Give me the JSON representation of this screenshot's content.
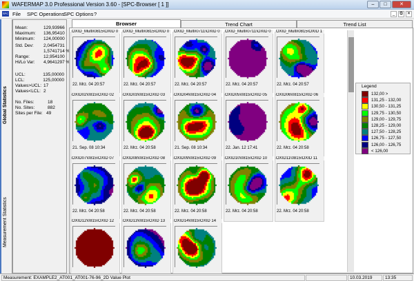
{
  "window": {
    "title": "WAFERMAP 3.0  Professional Version 3.60 - [SPC-Browser [ 1 ]]",
    "controls": [
      "–",
      "□",
      "✕"
    ]
  },
  "menu": {
    "logo": "SPC",
    "items": [
      "File",
      "SPC Operations",
      "SPC Options",
      "?"
    ],
    "mdi_controls": [
      "_",
      "⧉",
      "✕"
    ]
  },
  "side_tabs": [
    "Global Statistics",
    "Measurement Statistics"
  ],
  "stats": [
    {
      "label": "Mean:",
      "value": "129,93966"
    },
    {
      "label": "Maximum:",
      "value": "136,95410"
    },
    {
      "label": "Minimum:",
      "value": "124,00000"
    },
    {
      "label": "Std. Dev:",
      "value": "2,0454731"
    },
    {
      "label": "",
      "value": "1,5741714 %"
    },
    {
      "label": "Range:",
      "value": "12,954100"
    },
    {
      "label": "Hi/Lo Var:",
      "value": "4,9641297 %"
    },
    {
      "label": "UCL:",
      "value": "135,00000"
    },
    {
      "label": "LCL:",
      "value": "125,00000"
    },
    {
      "label": "Values>UCL:",
      "value": "17"
    },
    {
      "label": "Values<LCL:",
      "value": "2"
    },
    {
      "label": "No. Files:",
      "value": "18"
    },
    {
      "label": "No. Sites:",
      "value": "882"
    },
    {
      "label": "Sites per File:",
      "value": "49"
    }
  ],
  "tabs": [
    {
      "label": "Browser",
      "active": true
    },
    {
      "label": "Trend Chart"
    },
    {
      "label": "Trend List"
    }
  ],
  "wafers": [
    {
      "label": "OXID_Multi\\0815\\OXID 0",
      "date": "22. Mrz. 04 20:57"
    },
    {
      "label": "OXID_Multi\\0815\\OXID 0",
      "date": "22. Mrz. 04 20:57"
    },
    {
      "label": "OXID_Multi\\0711\\OXID 0",
      "date": "22. Mrz. 04 20:57"
    },
    {
      "label": "OXID_Multi\\0711\\OXID 0",
      "date": "22. Mrz. 04 20:57"
    },
    {
      "label": "OXID_Multi\\0815\\OXID 1",
      "date": "22. Mrz. 04 20:57"
    },
    {
      "label": "OXID02\\0815\\OXID 02",
      "date": "21. Sep. 08 10:34"
    },
    {
      "label": "OXID03\\0815\\OXID 03",
      "date": "22. Mrz. 04 20:58"
    },
    {
      "label": "OXID04\\0815\\OXID 04",
      "date": "21. Sep. 08 10:34"
    },
    {
      "label": "OXID05\\0815\\OXID 05",
      "date": "22. Jan. 12 17:41"
    },
    {
      "label": "OXID06\\0815\\OXID 06",
      "date": "22. Mrz. 04 20:58"
    },
    {
      "label": "OXID07\\0815\\OXID 07",
      "date": "22. Mrz. 04 20:58"
    },
    {
      "label": "OXID08\\0815\\OXID 08",
      "date": "22. Mrz. 04 20:58"
    },
    {
      "label": "OXID09\\0815\\OXID 09",
      "date": "22. Mrz. 04 20:58"
    },
    {
      "label": "OXID10\\0815\\OXID 10",
      "date": "22. Mrz. 04 20:58"
    },
    {
      "label": "OXID11\\0815\\OXID 11",
      "date": "22. Mrz. 04 20:58"
    },
    {
      "label": "OXID12\\0815\\OXID 12",
      "date": ""
    },
    {
      "label": "OXID13\\0815\\OXID 13",
      "date": ""
    },
    {
      "label": "OXID14\\0815\\OXID 14",
      "date": ""
    }
  ],
  "legend": {
    "title": "Legend",
    "items": [
      {
        "label": "132,00 >",
        "color": "#800000"
      },
      {
        "label": "131,25 - 132,00",
        "color": "#ff0000"
      },
      {
        "label": "130,50 - 131,25",
        "color": "#ffff00"
      },
      {
        "label": "129,75 - 130,50",
        "color": "#00ff00"
      },
      {
        "label": "129,00 - 129,75",
        "color": "#808000"
      },
      {
        "label": "128,25 - 129,00",
        "color": "#008000"
      },
      {
        "label": "127,50 - 128,25",
        "color": "#008080"
      },
      {
        "label": "126,75 - 127,50",
        "color": "#0000ff"
      },
      {
        "label": "126,00 - 126,75",
        "color": "#000080"
      },
      {
        "label": "< 126,00",
        "color": "#800080"
      }
    ]
  },
  "status": {
    "measurement": "Measurement: EXAMPLE2_AT001_AT001-76-96_2D Value Plot",
    "date": "10.03.2019",
    "time": "13:35"
  }
}
